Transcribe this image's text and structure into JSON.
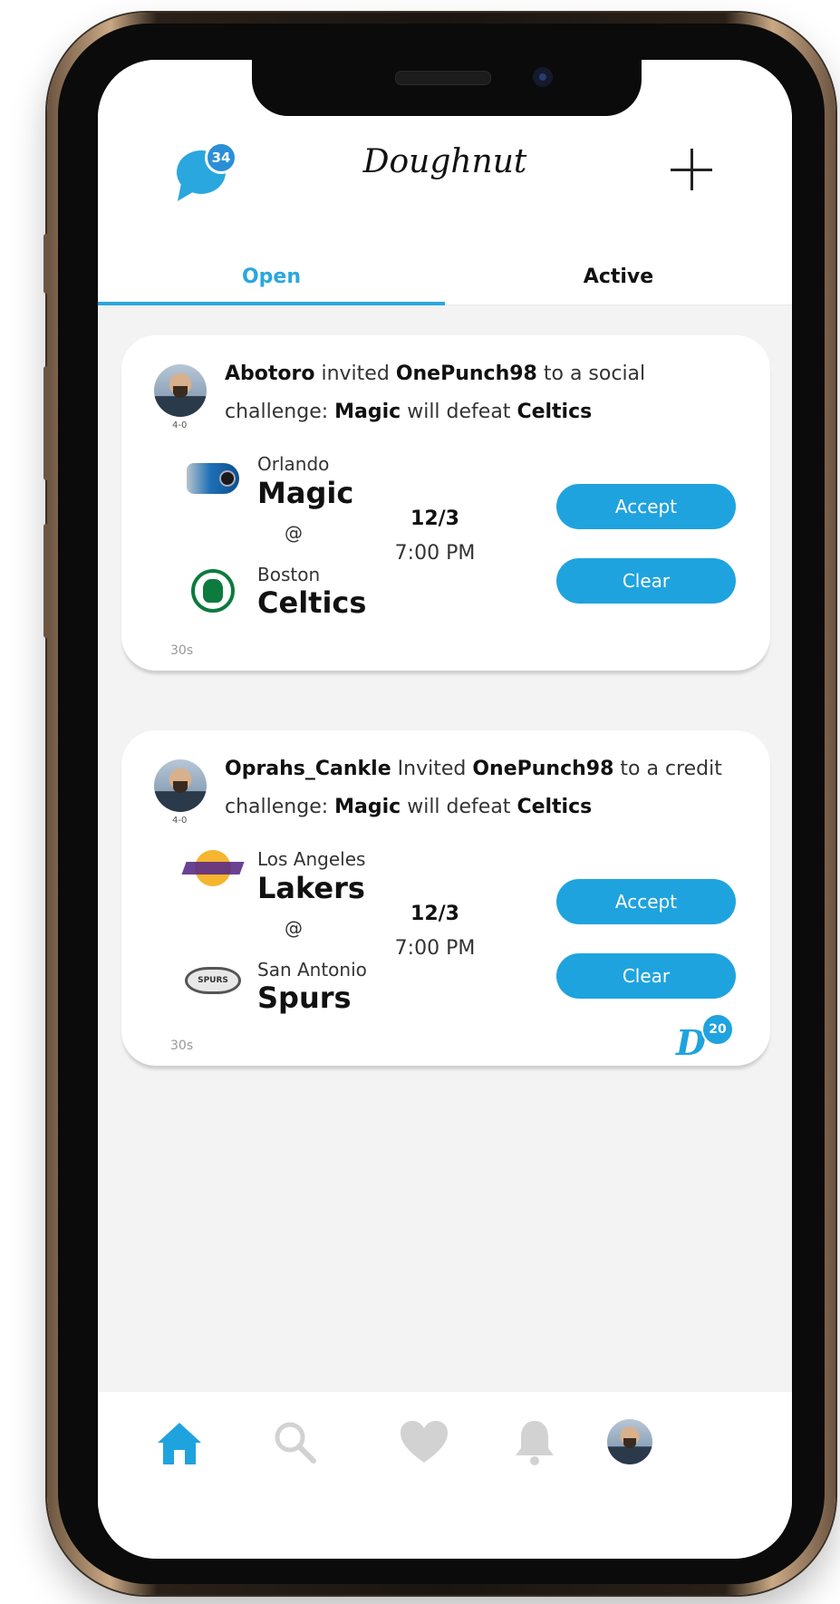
{
  "header": {
    "title": "Doughnut",
    "messages_badge": "34"
  },
  "tabs": [
    {
      "label": "Open",
      "selected": true
    },
    {
      "label": "Active",
      "selected": false
    }
  ],
  "challenges": [
    {
      "inviter": "Abotoro",
      "verb": "invited",
      "invitee": "OnePunch98",
      "challenge_intro": "to a social challenge:",
      "pick_team": "Magic",
      "pick_verb": "will defeat",
      "opponent_team": "Celtics",
      "inviter_record": "4-0",
      "away": {
        "city": "Orlando",
        "team": "Magic"
      },
      "at": "@",
      "home": {
        "city": "Boston",
        "team": "Celtics"
      },
      "date": "12/3",
      "time": "7:00 PM",
      "accept_label": "Accept",
      "clear_label": "Clear",
      "age": "30s"
    },
    {
      "inviter": "Oprahs_Cankle",
      "verb": "Invited",
      "invitee": "OnePunch98",
      "challenge_intro": "to a credit challenge:",
      "pick_team": "Magic",
      "pick_verb": "will defeat",
      "opponent_team": "Celtics",
      "inviter_record": "4-0",
      "away": {
        "city": "Los Angeles",
        "team": "Lakers"
      },
      "at": "@",
      "home": {
        "city": "San Antonio",
        "team": "Spurs"
      },
      "date": "12/3",
      "time": "7:00 PM",
      "accept_label": "Accept",
      "clear_label": "Clear",
      "age": "30s",
      "credit_amount": "20"
    }
  ],
  "nav": [
    {
      "icon": "home-icon",
      "active": true
    },
    {
      "icon": "search-icon",
      "active": false
    },
    {
      "icon": "heart-icon",
      "active": false
    },
    {
      "icon": "bell-icon",
      "active": false
    },
    {
      "icon": "profile-avatar",
      "active": false
    }
  ],
  "colors": {
    "accent": "#1fa3de",
    "inactive_icon": "#d2d2d2",
    "screen_bg": "#f3f3f3"
  }
}
